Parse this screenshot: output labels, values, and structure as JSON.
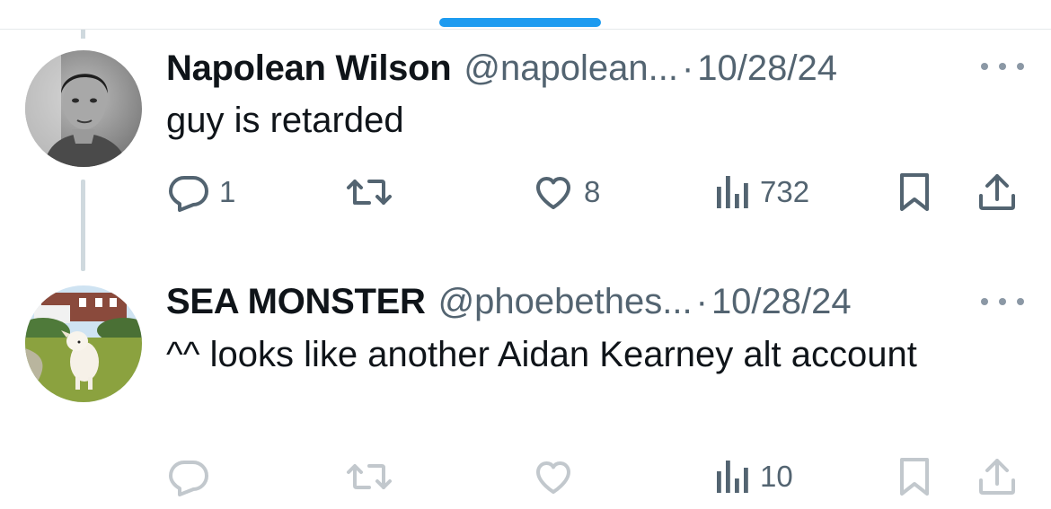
{
  "tweets": [
    {
      "display_name": "Napolean Wilson",
      "handle": "@napolean...",
      "separator": "·",
      "date": "10/28/24",
      "text": "guy is retarded",
      "reply_count": "1",
      "retweet_count": "",
      "like_count": "8",
      "view_count": "732",
      "avatar": "grayscale-portrait-man"
    },
    {
      "display_name": "SEA MONSTER",
      "handle": "@phoebethes...",
      "separator": "·",
      "date": "10/28/24",
      "text": "^^ looks like another Aidan Kearney alt account",
      "reply_count": "",
      "retweet_count": "",
      "like_count": "",
      "view_count": "10",
      "avatar": "white-dog-on-lawn"
    }
  ],
  "icons": {
    "reply": "reply-icon",
    "retweet": "retweet-icon",
    "like": "heart-icon",
    "views": "views-chart-icon",
    "bookmark": "bookmark-icon",
    "share": "share-icon",
    "more": "more-options-icon"
  },
  "colors": {
    "accent": "#1d9bf0",
    "text_primary": "#0f1419",
    "text_secondary": "#536471",
    "thread_line": "#cfd9de"
  }
}
